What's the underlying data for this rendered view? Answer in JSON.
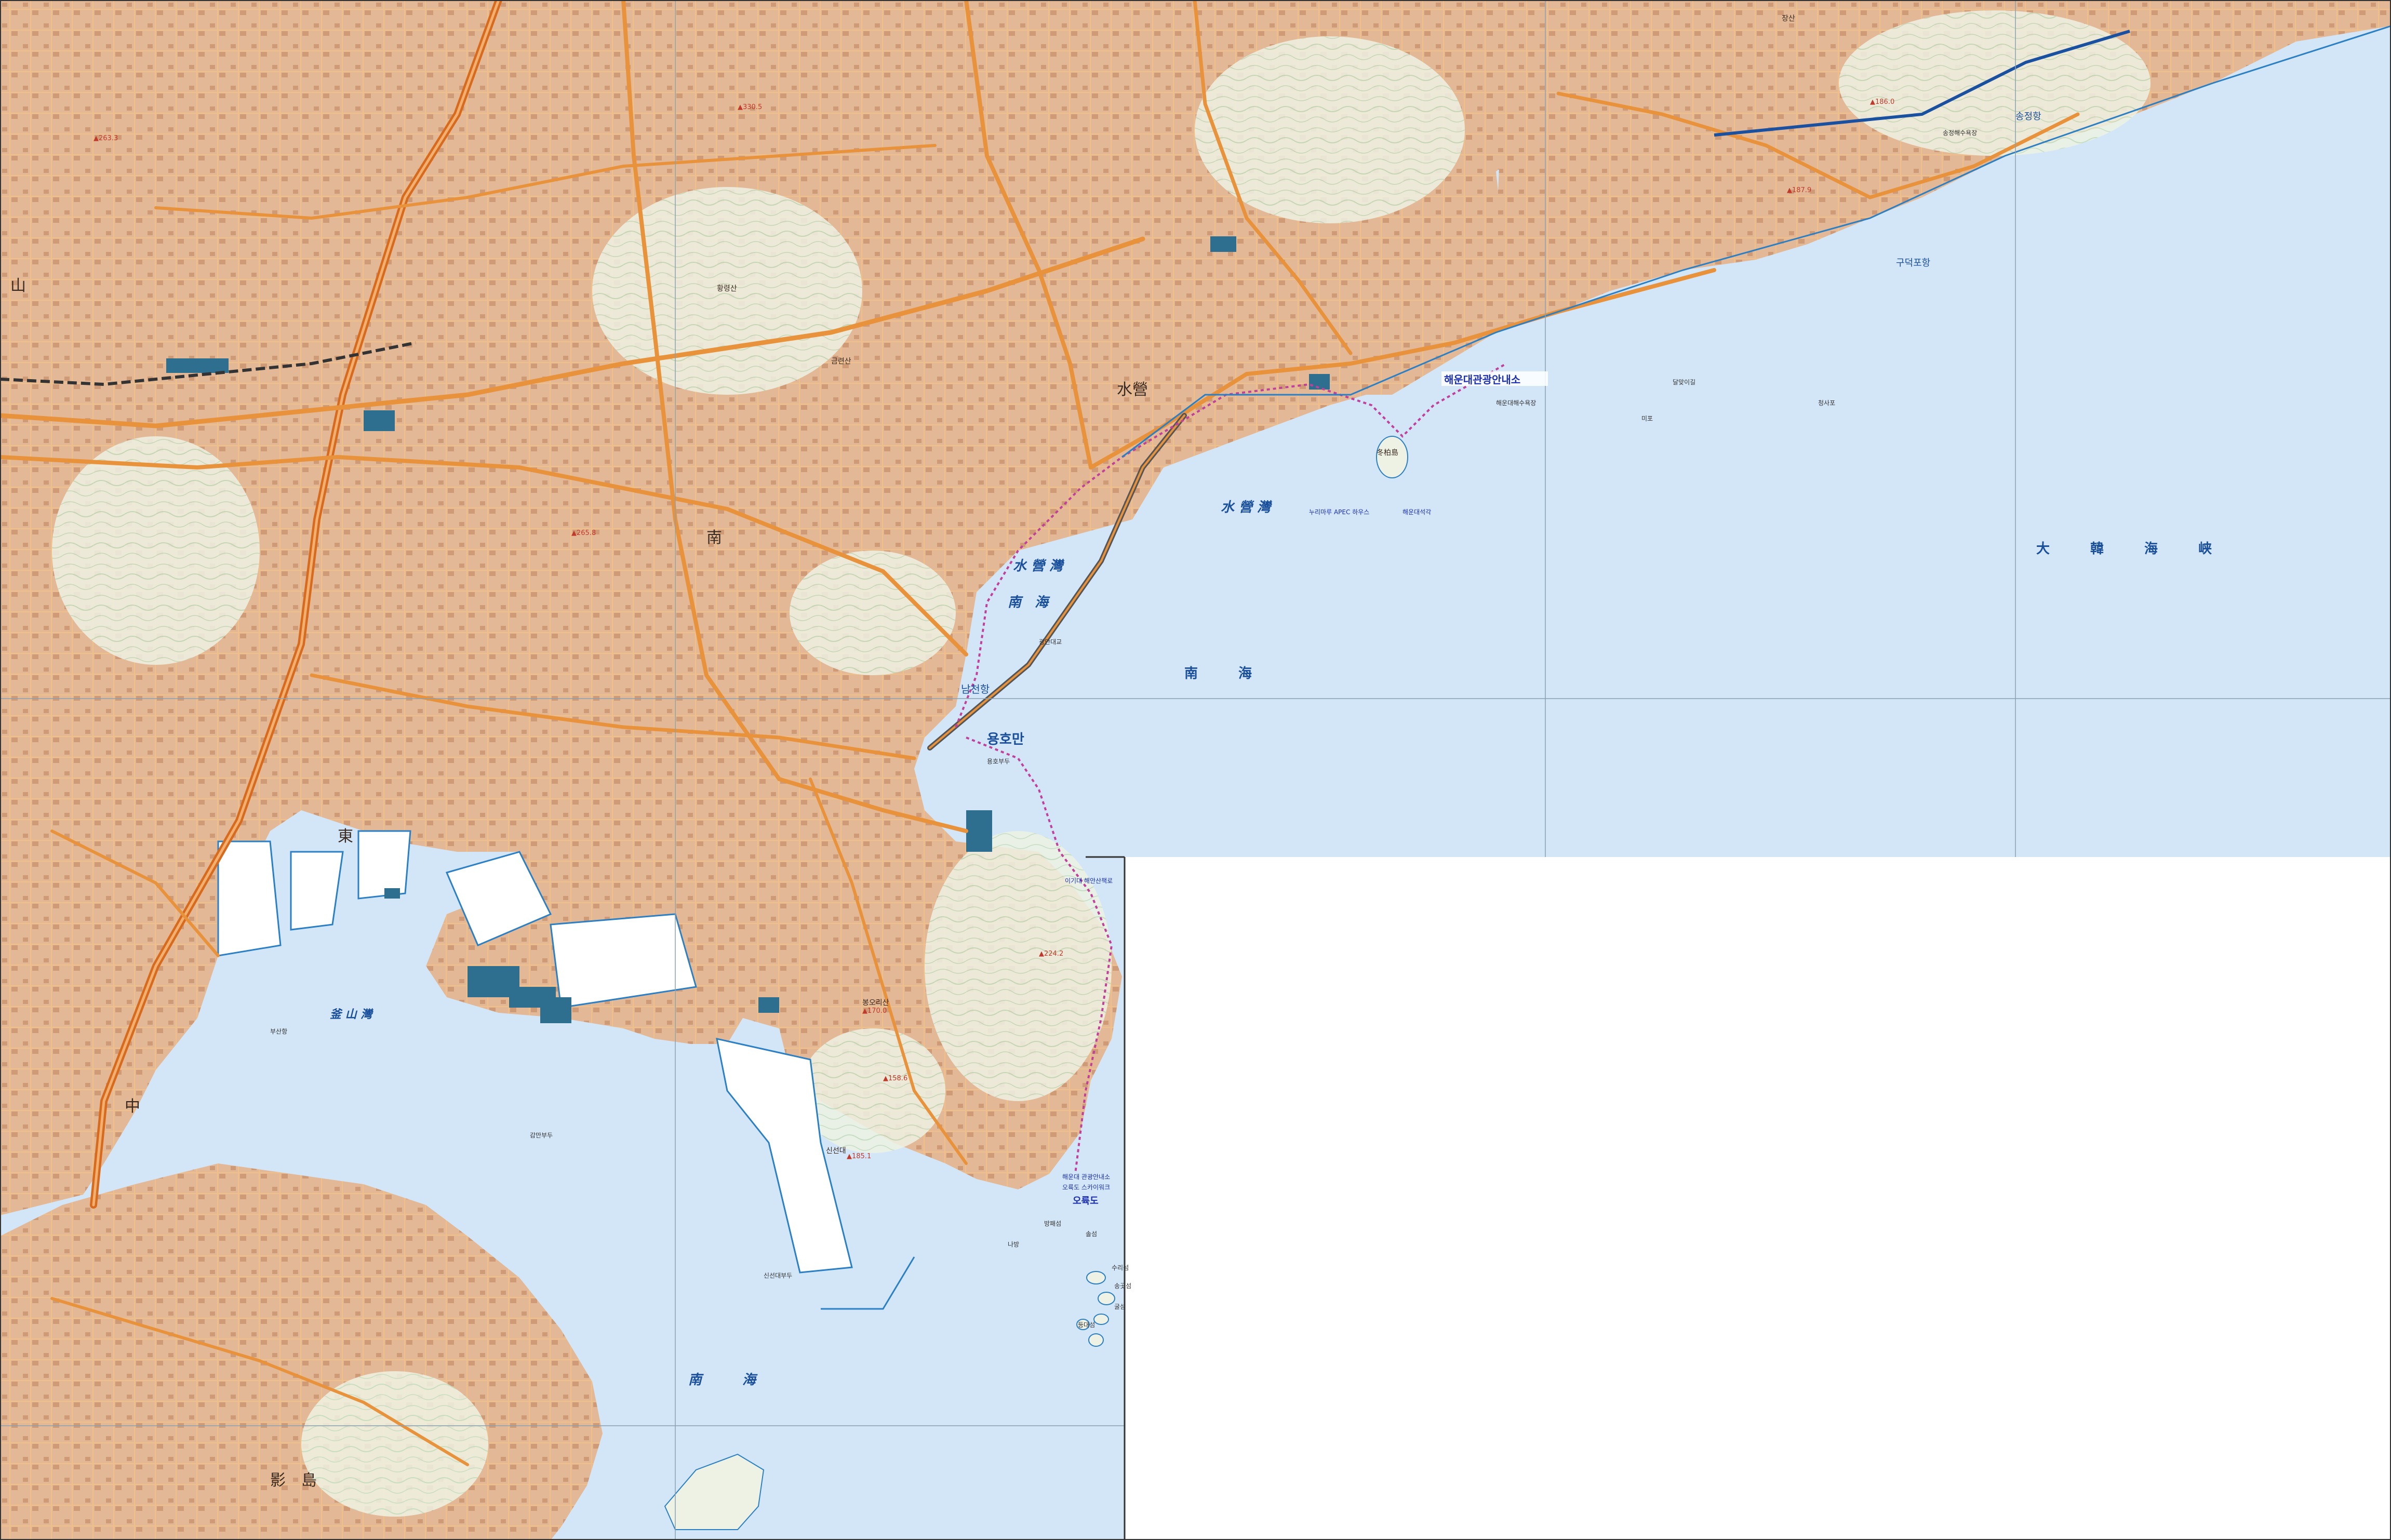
{
  "colors": {
    "sea": "#d3e6f7",
    "sea_edge": "#2b7fc4",
    "land": "#f1f0e6",
    "urban": "#e3b99a",
    "road": "#e8923c",
    "expressway": "#d86a1e",
    "rail": "#555555",
    "contour": "#b8d8b0",
    "building": "#2e6e8e",
    "trail": "#c0409a",
    "water_text": "#1a4f9c",
    "poi_text": "#1b2fb0",
    "height_text": "#c0392b",
    "blank": "#ffffff"
  },
  "labels": {
    "sea_strait": "大　　　韓　　　海　　　峡",
    "sea_south_east": "南　　　海",
    "sea_south_bay": "南　海",
    "sea_south_lower": "南　　　海",
    "suyeong_bay_1": "水 營 灣",
    "suyeong_bay_2": "水 營 灣",
    "busan_bay": "釜 山 灣",
    "yonghoman": "용호만",
    "namcheonhang": "남천항",
    "gudeokpohang": "구덕포항",
    "songjeonghang": "송정항",
    "haeundae_info": "해운대관광안내소",
    "oryukdo": "오륙도",
    "district_nam": "南",
    "district_suyeong": "水營",
    "district_dong": "東",
    "district_jung": "中",
    "yeongdo": "影　島",
    "dongbaek": "冬柏島",
    "district_sasang": "山"
  },
  "islands": [
    "솔섬",
    "수리섬",
    "송곳섬",
    "굴섬",
    "등대섬",
    "나방",
    "방패섬"
  ],
  "poi_small": [
    "누리마루 APEC 하우스",
    "해운대석각",
    "해운대해수욕장",
    "해운대 관광안내소",
    "오륙도 스카이워크",
    "이기대 해안산책로",
    "광안대교",
    "신선대부두",
    "감만부두",
    "부산항",
    "용호부두",
    "장산",
    "황령산",
    "금련산",
    "봉오리산",
    "신선대",
    "청사포",
    "달맞이길",
    "미포",
    "송정해수욕장"
  ],
  "heights": [
    "▲224.2",
    "▲170.0",
    "▲185.1",
    "▲158.6",
    "▲330.5",
    "▲265.8",
    "▲187.9",
    "▲186.0",
    "▲263.3"
  ]
}
